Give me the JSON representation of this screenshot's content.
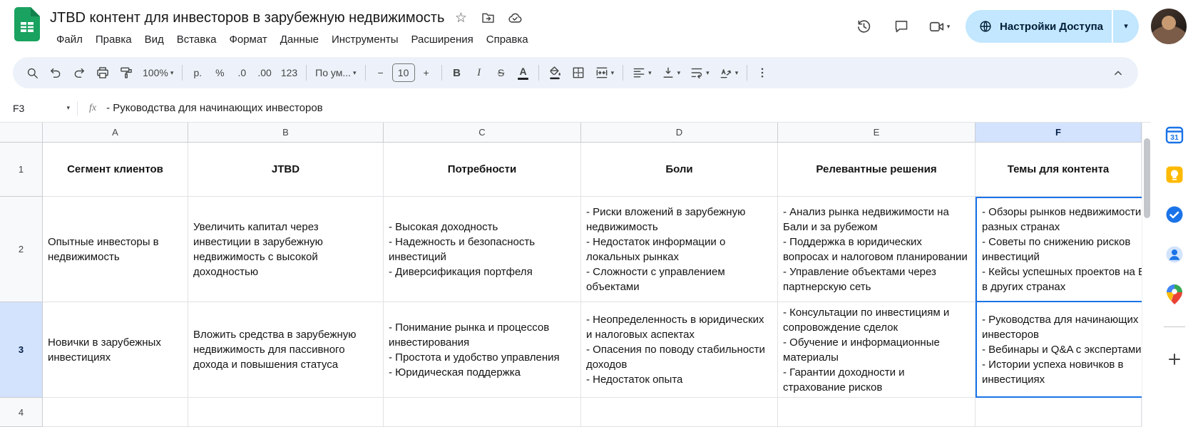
{
  "topbar": {
    "title": "JTBD контент для инвесторов в зарубежную недвижимость",
    "menus": [
      "Файл",
      "Правка",
      "Вид",
      "Вставка",
      "Формат",
      "Данные",
      "Инструменты",
      "Расширения",
      "Справка"
    ],
    "share_label": "Настройки Доступа"
  },
  "toolbar": {
    "zoom": "100%",
    "currency": "р.",
    "percent": "%",
    "decimal_decrease": ".0",
    "decimal_increase": ".00",
    "number_format": "123",
    "font_name": "По ум...",
    "font_size": "10",
    "bold": "B",
    "italic": "I",
    "strikethrough": "S",
    "text_color": "A"
  },
  "formula_bar": {
    "cell_ref": "F3",
    "fx_label": "fx",
    "value": "- Руководства для начинающих инвесторов"
  },
  "grid": {
    "column_letters": [
      "A",
      "B",
      "C",
      "D",
      "E",
      "F"
    ],
    "row_numbers": [
      "1",
      "2",
      "3",
      "4"
    ],
    "selected_cell": "F3",
    "header_row": [
      "Сегмент клиентов",
      "JTBD",
      "Потребности",
      "Боли",
      "Релевантные решения",
      "Темы для контента"
    ],
    "row2": {
      "a": "Опытные инвесторы в недвижимость",
      "b": "Увеличить капитал через инвестиции в зарубежную недвижимость с высокой доходностью",
      "c": "- Высокая доходность\n- Надежность и безопасность инвестиций\n- Диверсификация портфеля",
      "d": "- Риски вложений в зарубежную недвижимость\n- Недостаток информации о локальных рынках\n- Сложности с управлением объектами",
      "e": "- Анализ рынка недвижимости на Бали и за рубежом\n- Поддержка в юридических вопросах и налоговом планировании\n- Управление объектами через партнерскую сеть",
      "f": "- Обзоры рынков недвижимости в разных странах\n- Советы по снижению рисков инвестиций\n- Кейсы успешных проектов на Бали и в других странах"
    },
    "row3": {
      "a": "Новички в зарубежных инвестициях",
      "b": "Вложить средства в зарубежную недвижимость для пассивного дохода и повышения статуса",
      "c": "- Понимание рынка и процессов инвестирования\n- Простота и удобство управления\n- Юридическая поддержка",
      "d": "- Неопределенность в юридических и налоговых аспектах\n- Опасения по поводу стабильности доходов\n- Недостаток опыта",
      "e": "- Консультации по инвестициям и сопровождение сделок\n- Обучение и информационные материалы\n- Гарантии доходности и страхование рисков",
      "f": "- Руководства для начинающих инвесторов\n- Вебинары и Q&A с экспертами\n- Истории успеха новичков в инвестициях"
    }
  },
  "side_rail": {
    "calendar_day": "31"
  },
  "glyphs": {
    "caret_down": "▾",
    "minus": "−",
    "plus": "+",
    "star": "☆"
  },
  "colors": {
    "accent": "#1a73e8",
    "selection_bg": "#d3e3fd",
    "share_button_bg": "#c2e7ff",
    "sheets_green": "#1aa260",
    "toolbar_bg": "#edf2fa"
  },
  "icons": {
    "unicode": [
      "caret-down",
      "star"
    ],
    "svg": [
      "sheets-logo",
      "move-folder",
      "cloud-saved",
      "history",
      "comment",
      "video-camera",
      "globe",
      "search",
      "undo",
      "redo",
      "print",
      "paint-format",
      "fill-color",
      "borders",
      "merge-cells",
      "align-left",
      "vertical-align",
      "text-wrap",
      "text-rotation",
      "more-vert",
      "collapse-toolbar",
      "calendar",
      "keep",
      "tasks",
      "contacts",
      "maps",
      "plus"
    ]
  }
}
